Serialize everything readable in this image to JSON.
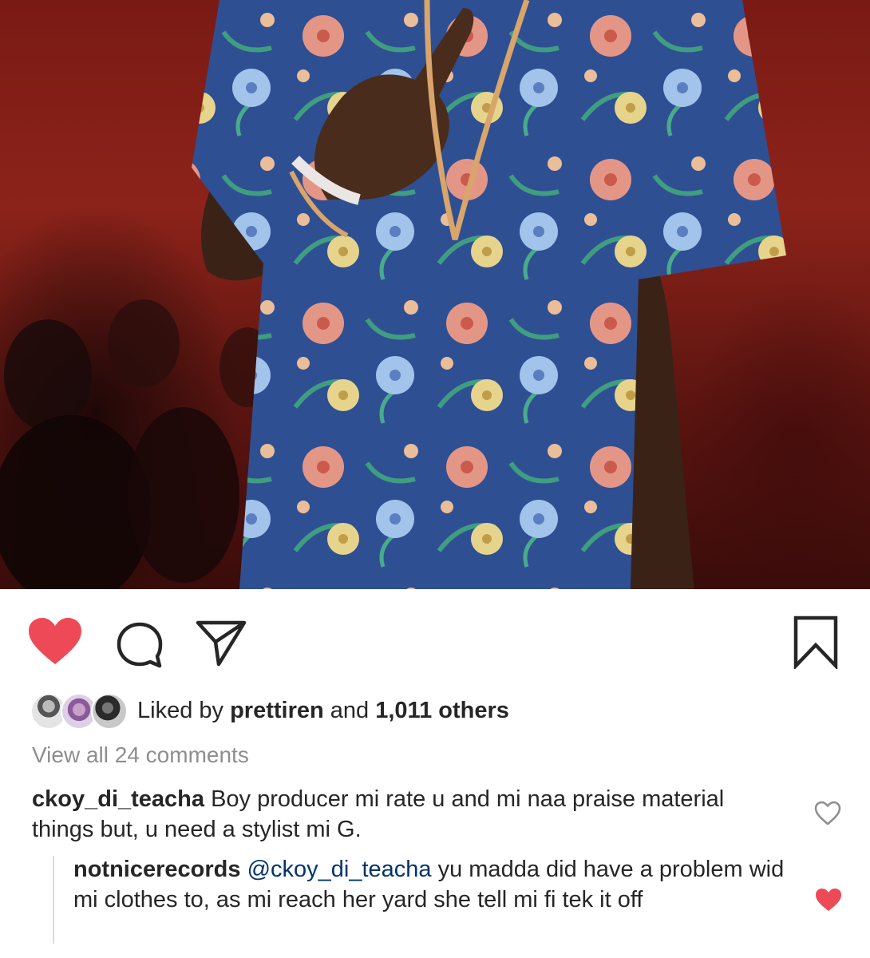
{
  "post": {
    "image_description_icon": "photo-of-man-in-floral-shirt"
  },
  "actions": {
    "like_icon": "heart-filled-icon",
    "comment_icon": "comment-bubble-icon",
    "share_icon": "paper-plane-icon",
    "save_icon": "bookmark-icon",
    "like_color": "#ed4956"
  },
  "likes": {
    "prefix": "Liked by",
    "user": "prettiren",
    "conjunction": "and",
    "others": "1,011 others"
  },
  "view_all": "View all 24 comments",
  "comment": {
    "user": "ckoy_di_teacha",
    "text": "Boy producer mi rate u and mi naa praise material things but, u need a stylist mi G.",
    "liked": false
  },
  "reply": {
    "user": "notnicerecords",
    "mention": "@ckoy_di_teacha",
    "text": "yu madda did have a problem wid mi clothes to, as mi reach her yard she tell mi fi tek it off",
    "liked": true
  }
}
